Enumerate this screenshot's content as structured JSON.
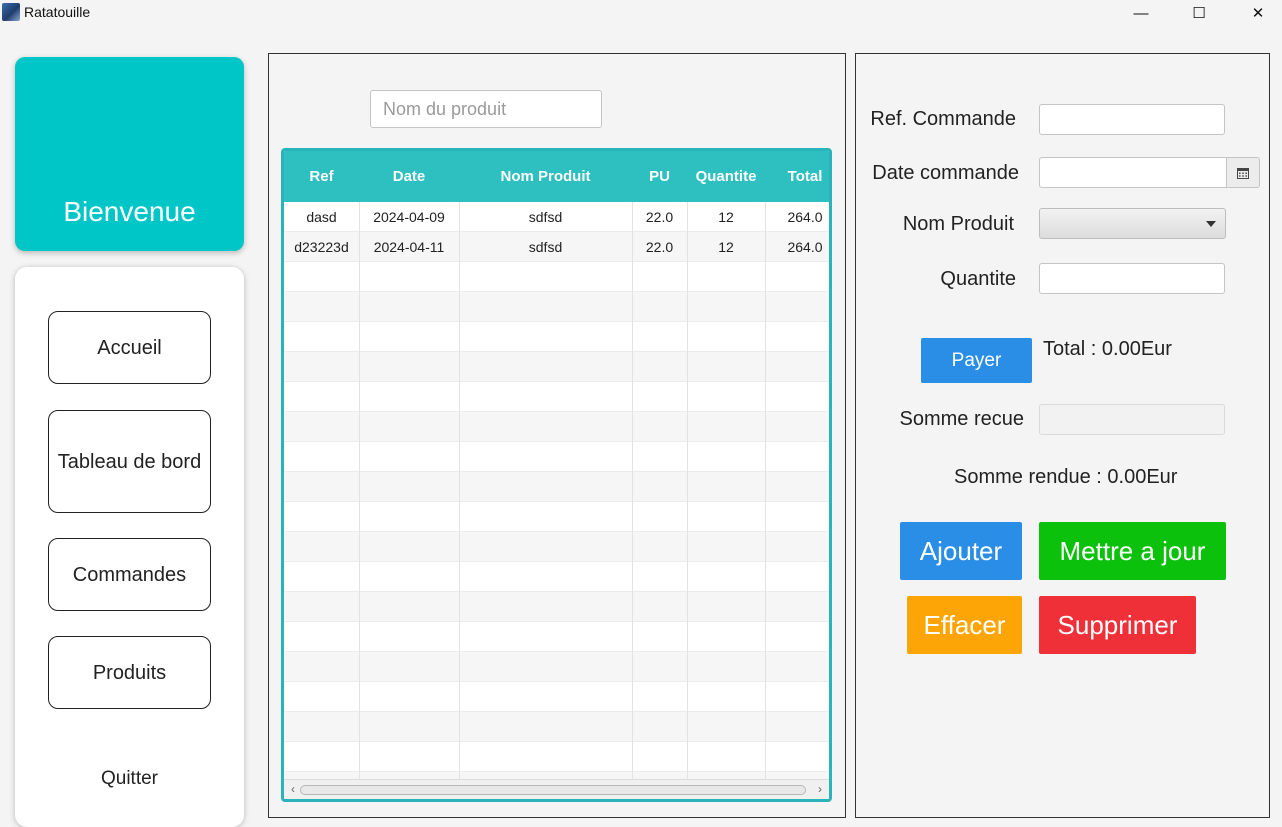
{
  "window": {
    "title": "Ratatouille",
    "icon": "app-icon",
    "controls": {
      "minimize": "—",
      "maximize": "☐",
      "close": "✕"
    }
  },
  "sidebar": {
    "welcome": "Bienvenue",
    "nav": {
      "accueil": "Accueil",
      "tableau": "Tableau de bord",
      "commandes": "Commandes",
      "produits": "Produits",
      "quitter": "Quitter"
    }
  },
  "search": {
    "placeholder": "Nom du produit",
    "value": ""
  },
  "table": {
    "columns": [
      "Ref",
      "Date",
      "Nom Produit",
      "PU",
      "Quantite",
      "Total"
    ],
    "rows": [
      [
        "dasd",
        "2024-04-09",
        "sdfsd",
        "22.0",
        "12",
        "264.0"
      ],
      [
        "d23223d",
        "2024-04-11",
        "sdfsd",
        "22.0",
        "12",
        "264.0"
      ]
    ]
  },
  "form": {
    "ref_label": "Ref. Commande",
    "ref_value": "",
    "date_label": "Date commande",
    "date_value": "",
    "produit_label": "Nom Produit",
    "produit_value": "",
    "quantite_label": "Quantite",
    "quantite_value": "",
    "payer": "Payer",
    "total": "Total : 0.00Eur",
    "somme_recue_label": "Somme recue",
    "somme_recue_value": "",
    "somme_rendue": "Somme rendue : 0.00Eur"
  },
  "actions": {
    "ajouter": "Ajouter",
    "mettre_a_jour": "Mettre a jour",
    "effacer": "Effacer",
    "supprimer": "Supprimer"
  },
  "colors": {
    "welcome_bg": "#00c6c8",
    "table_header": "#2ebfc1",
    "blue": "#2b8ee6",
    "green": "#0bc10b",
    "orange": "#fda506",
    "red": "#ef3038"
  }
}
